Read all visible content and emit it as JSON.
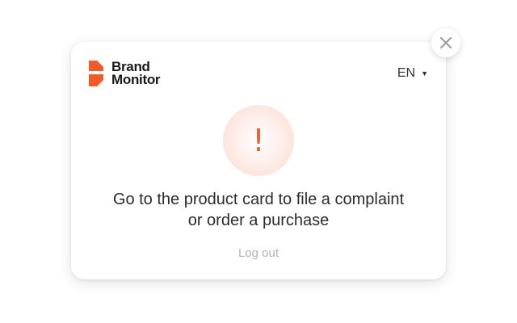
{
  "brand": {
    "line1": "Brand",
    "line2": "Monitor",
    "accent_color": "#f15a29"
  },
  "language": {
    "selected": "EN",
    "caret_icon": "caret-down-icon"
  },
  "dialog": {
    "icon": "exclamation-icon",
    "message_line1": "Go to the product card to file a complaint",
    "message_line2": "or order a purchase",
    "logout_label": "Log out"
  },
  "close_icon": "close-icon"
}
